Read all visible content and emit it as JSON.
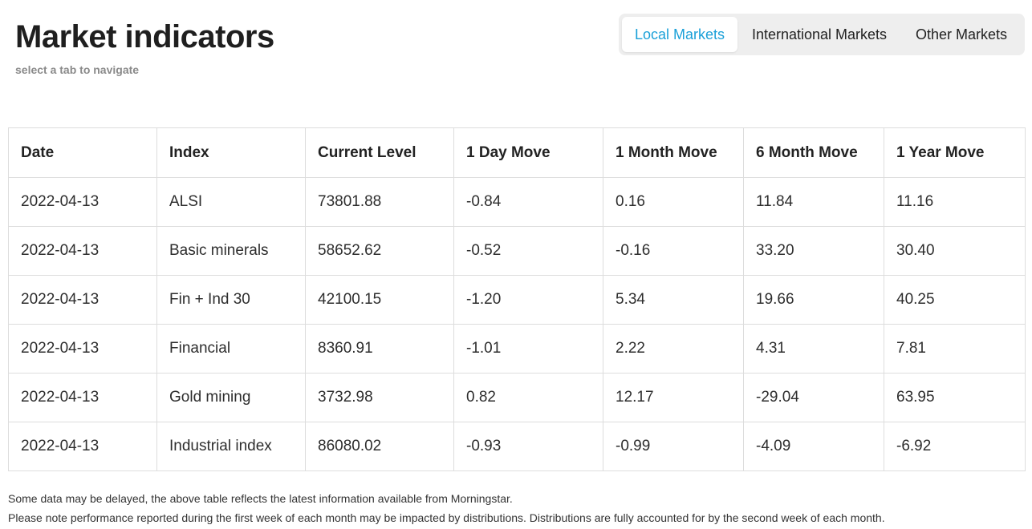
{
  "header": {
    "title": "Market indicators",
    "subtitle": "select a tab to navigate"
  },
  "tabs": [
    {
      "label": "Local Markets",
      "active": true
    },
    {
      "label": "International Markets",
      "active": false
    },
    {
      "label": "Other Markets",
      "active": false
    }
  ],
  "table": {
    "columns": [
      "Date",
      "Index",
      "Current Level",
      "1 Day Move",
      "1 Month Move",
      "6 Month Move",
      "1 Year Move"
    ],
    "rows": [
      [
        "2022-04-13",
        "ALSI",
        "73801.88",
        "-0.84",
        "0.16",
        "11.84",
        "11.16"
      ],
      [
        "2022-04-13",
        "Basic minerals",
        "58652.62",
        "-0.52",
        "-0.16",
        "33.20",
        "30.40"
      ],
      [
        "2022-04-13",
        "Fin + Ind 30",
        "42100.15",
        "-1.20",
        "5.34",
        "19.66",
        "40.25"
      ],
      [
        "2022-04-13",
        "Financial",
        "8360.91",
        "-1.01",
        "2.22",
        "4.31",
        "7.81"
      ],
      [
        "2022-04-13",
        "Gold mining",
        "3732.98",
        "0.82",
        "12.17",
        "-29.04",
        "63.95"
      ],
      [
        "2022-04-13",
        "Industrial index",
        "86080.02",
        "-0.93",
        "-0.99",
        "-4.09",
        "-6.92"
      ]
    ]
  },
  "footnotes": {
    "line1": "Some data may be delayed, the above table reflects the latest information available from Morningstar.",
    "line2": "Please note performance reported during the first week of each month may be impacted by distributions. Distributions are fully accounted for by the second week of each month."
  },
  "colors": {
    "accent": "#1aa0d8",
    "tab_bg": "#eeeeee",
    "border": "#dddddd"
  }
}
